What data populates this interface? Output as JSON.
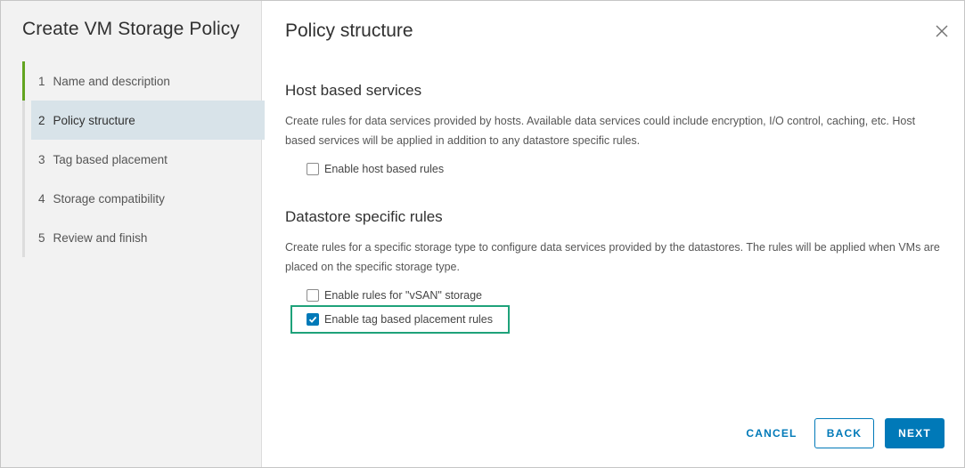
{
  "sidebar": {
    "title": "Create VM Storage Policy",
    "steps": [
      {
        "num": "1",
        "label": "Name and description",
        "state": "completed"
      },
      {
        "num": "2",
        "label": "Policy structure",
        "state": "active"
      },
      {
        "num": "3",
        "label": "Tag based placement",
        "state": "pending"
      },
      {
        "num": "4",
        "label": "Storage compatibility",
        "state": "pending"
      },
      {
        "num": "5",
        "label": "Review and finish",
        "state": "pending"
      }
    ]
  },
  "main": {
    "title": "Policy structure",
    "host_section": {
      "title": "Host based services",
      "description": "Create rules for data services provided by hosts. Available data services could include encryption, I/O control, caching, etc. Host based services will be applied in addition to any datastore specific rules.",
      "checkbox_label": "Enable host based rules",
      "checked": false
    },
    "datastore_section": {
      "title": "Datastore specific rules",
      "description": "Create rules for a specific storage type to configure data services provided by the datastores. The rules will be applied when VMs are placed on the specific storage type.",
      "vsan_label": "Enable rules for \"vSAN\" storage",
      "vsan_checked": false,
      "tag_label": "Enable tag based placement rules",
      "tag_checked": true
    }
  },
  "footer": {
    "cancel_label": "CANCEL",
    "back_label": "BACK",
    "next_label": "NEXT"
  },
  "colors": {
    "accent": "#0079b8",
    "completed_step": "#62a420",
    "highlight": "#1ea27a",
    "active_step_bg": "#d8e3e9"
  },
  "icons": {
    "close": "close-icon",
    "check": "checkmark-icon"
  }
}
